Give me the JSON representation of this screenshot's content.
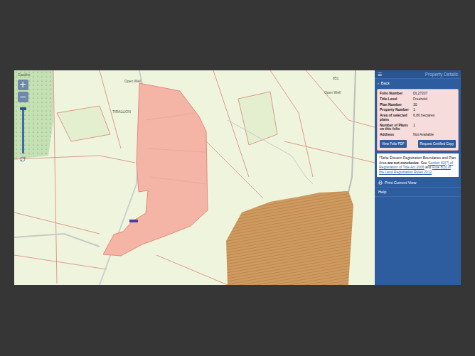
{
  "map": {
    "labels": [
      "Gaoithe",
      "Open Well",
      "Open Well",
      "TIRALLION",
      "851"
    ],
    "zoom": {
      "in": "+",
      "out": "−",
      "level": 0.92
    }
  },
  "panel": {
    "menu_icon": "☰",
    "title": "Property Details",
    "back": {
      "icon": "›",
      "label": "Back"
    },
    "details": [
      {
        "label": "Folio Number",
        "value": "DL27207"
      },
      {
        "label": "Title Level",
        "value": "Freehold"
      },
      {
        "label": "Plan Number",
        "value": "30"
      },
      {
        "label": "Property Number",
        "value": "1"
      },
      {
        "label": "Area of selected plans",
        "value": "6.80 hectares"
      },
      {
        "label": "Number of Plans on this folio",
        "value": "1"
      },
      {
        "label": "Address",
        "value": "Not Available"
      }
    ],
    "buttons": [
      "View Folio PDF",
      "Request Certified Copy"
    ],
    "note": [
      {
        "text": "*Tailte Éireann Registration Boundaries and Plan Area ",
        "kind": "plain"
      },
      {
        "text": "are not conclusive",
        "kind": "bold"
      },
      {
        "text": ". See ",
        "kind": "plain"
      },
      {
        "text": "Section 62(7) of Registration of Title Act 2006",
        "kind": "link"
      },
      {
        "text": " and ",
        "kind": "plain"
      },
      {
        "text": "Rule 8(3) of the Land Registration Rules 2012",
        "kind": "link"
      },
      {
        "text": ".",
        "kind": "plain"
      }
    ],
    "links": [
      {
        "label": "Print Current View",
        "icon": true
      },
      {
        "label": "Help",
        "icon": false
      }
    ]
  }
}
